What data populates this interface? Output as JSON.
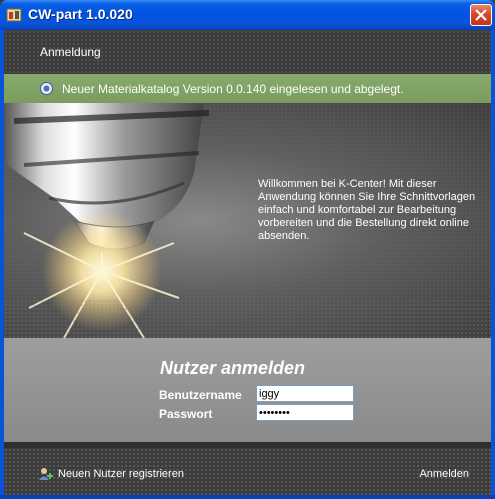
{
  "window": {
    "title": "CW-part 1.0.020"
  },
  "menu": {
    "items": [
      {
        "label": "Anmeldung"
      }
    ]
  },
  "notice": {
    "text": "Neuer Materialkatalog Version 0.0.140 eingelesen und abgelegt.",
    "icon": "info-icon"
  },
  "hero": {
    "welcome": "Willkommen bei K-Center! Mit dieser Anwendung können Sie Ihre Schnittvorlagen einfach und komfortabel zur Bearbeitung vorbereiten und die Bestellung direkt online absenden."
  },
  "login": {
    "heading": "Nutzer anmelden",
    "username_label": "Benutzername",
    "username_value": "iggy",
    "password_label": "Passwort",
    "password_value": "••••••••"
  },
  "footer": {
    "register_label": "Neuen Nutzer registrieren",
    "login_label": "Anmelden"
  },
  "colors": {
    "titlebar": "#0054e3",
    "notice": "#7a9c5e",
    "close": "#d6482a"
  }
}
